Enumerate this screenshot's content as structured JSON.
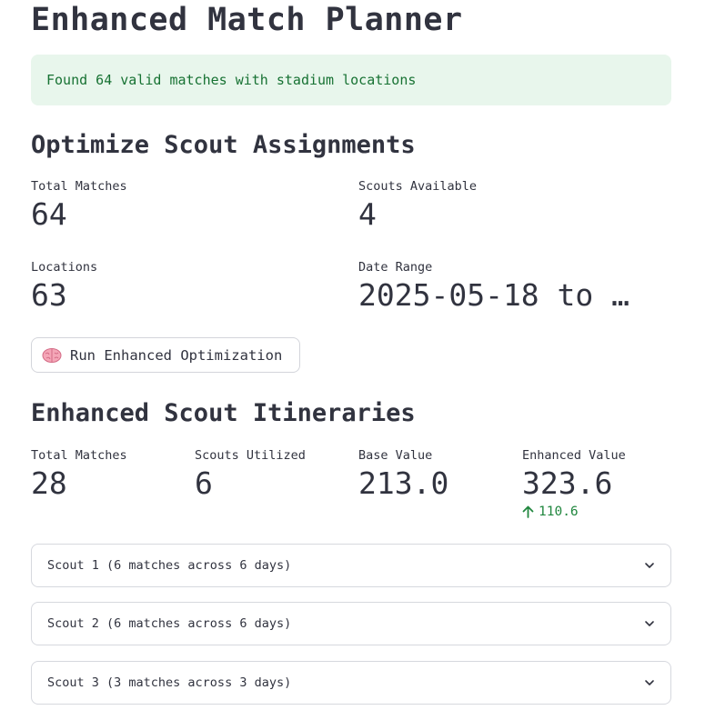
{
  "page": {
    "title": "Enhanced Match Planner"
  },
  "alert": {
    "message": "Found 64 valid matches with stadium locations",
    "color": "#177233",
    "background": "#e8f6ec"
  },
  "optimize": {
    "heading": "Optimize Scout Assignments",
    "metrics": [
      {
        "label": "Total Matches",
        "value": "64"
      },
      {
        "label": "Scouts Available",
        "value": "4"
      },
      {
        "label": "Locations",
        "value": "63"
      },
      {
        "label": "Date Range",
        "value": "2025-05-18 to …"
      }
    ],
    "run_button": {
      "icon": "brain-icon",
      "label": "Run Enhanced Optimization"
    }
  },
  "itineraries": {
    "heading": "Enhanced Scout Itineraries",
    "metrics": [
      {
        "label": "Total Matches",
        "value": "28"
      },
      {
        "label": "Scouts Utilized",
        "value": "6"
      },
      {
        "label": "Base Value",
        "value": "213.0"
      },
      {
        "label": "Enhanced Value",
        "value": "323.6",
        "delta": "110.6",
        "delta_direction": "up",
        "delta_color": "#21873f"
      }
    ],
    "scouts": [
      {
        "label": "Scout 1 (6 matches across 6 days)",
        "icon": "chevron-down-icon"
      },
      {
        "label": "Scout 2 (6 matches across 6 days)",
        "icon": "chevron-down-icon"
      },
      {
        "label": "Scout 3 (3 matches across 3 days)",
        "icon": "chevron-down-icon"
      }
    ]
  }
}
